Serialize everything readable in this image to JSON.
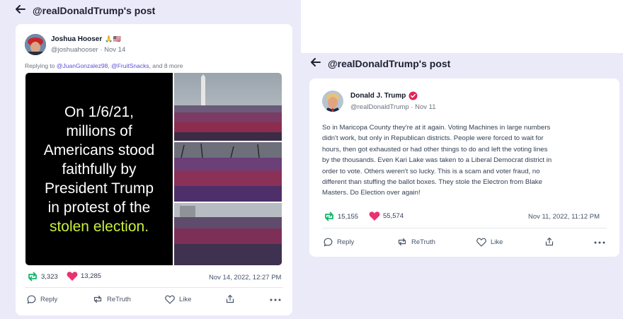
{
  "left_panel": {
    "header_title": "@realDonaldTrump's post",
    "post": {
      "author_name": "Joshua Hooser",
      "author_emoji": "🙏🇺🇸",
      "handle_date": "@joshuahooser · Nov 14",
      "replying_prefix": "Replying to ",
      "reply_mention_1": "@JuanGonzalez98",
      "reply_sep": ", ",
      "reply_mention_2": "@FruitSnacks",
      "reply_suffix": ", and 8 more",
      "image_text_lines": [
        "On 1/6/21,",
        "millions of",
        "Americans stood",
        "faithfully by",
        "President Trump",
        "in protest of the"
      ],
      "image_text_highlight": "stolen election.",
      "retruths": "3,323",
      "likes": "13,285",
      "timestamp": "Nov 14, 2022, 12:27 PM",
      "actions": {
        "reply": "Reply",
        "retruth": "ReTruth",
        "like": "Like"
      }
    }
  },
  "right_panel": {
    "header_title": "@realDonaldTrump's post",
    "post": {
      "author_name": "Donald J. Trump",
      "handle_date": "@realDonaldTrump · Nov 11",
      "body_lines": [
        "So in Maricopa County they're at it again. Voting Machines in large numbers",
        "didn't work, but only in Republican districts. People were forced to wait for",
        "hours, then got exhausted or had other things to do and left the voting lines",
        "by the thousands. Even Kari Lake was taken to a Liberal Democrat district in",
        "order to vote. Others weren't so lucky. This is a scam and voter fraud, no",
        "different than stuffing the ballot boxes. They stole the Electron from Blake",
        "Masters. Do Election over again!"
      ],
      "retruths": "15,155",
      "likes": "55,574",
      "timestamp": "Nov 11, 2022, 11:12 PM",
      "actions": {
        "reply": "Reply",
        "retruth": "ReTruth",
        "like": "Like"
      }
    }
  },
  "colors": {
    "background_panel": "#ebeaf8",
    "retruth_green": "#12b76a",
    "like_pink": "#e8336f",
    "mention_purple": "#5b4fd6",
    "verified_pink": "#e0245e"
  },
  "icons": [
    "back-arrow-icon",
    "retruth-icon",
    "heart-icon",
    "comment-icon",
    "like-icon",
    "share-icon",
    "more-icon",
    "verified-icon"
  ]
}
